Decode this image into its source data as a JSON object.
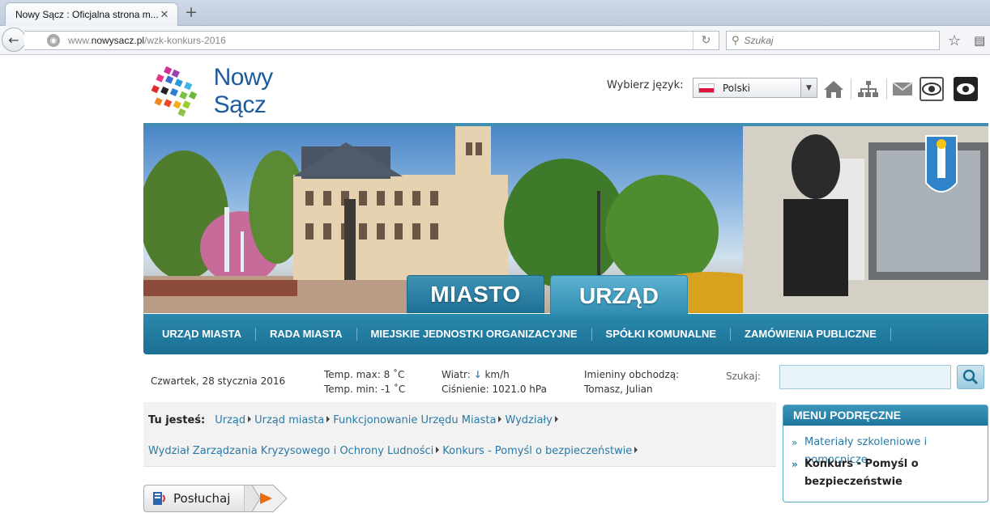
{
  "browser": {
    "tab_title": "Nowy Sącz : Oficjalna strona m...",
    "url_prefix": "www.",
    "url_domain": "nowysacz.pl",
    "url_path": "/wzk-konkurs-2016",
    "search_placeholder": "Szukaj"
  },
  "header": {
    "logo_text": "Nowy Sącz",
    "language_label": "Wybierz język:",
    "language_value": "Polski"
  },
  "banner": {
    "btn_miasto": "MIASTO",
    "btn_urzad": "URZĄD"
  },
  "nav": {
    "items": [
      "URZĄD MIASTA",
      "RADA MIASTA",
      "MIEJSKIE JEDNOSTKI ORGANIZACYJNE",
      "SPÓŁKI KOMUNALNE",
      "ZAMÓWIENIA PUBLICZNE"
    ]
  },
  "info": {
    "date": "Czwartek, 28 stycznia 2016",
    "temp_max": "Temp. max: 8 ˚C",
    "temp_min": "Temp. min: -1 ˚C",
    "wind_label": "Wiatr:",
    "wind_unit": "km/h",
    "pressure": "Ciśnienie: 1021.0 hPa",
    "nameday_label": "Imieniny obchodzą:",
    "nameday_names": "Tomasz, Julian",
    "search_label": "Szukaj:"
  },
  "breadcrumb": {
    "label": "Tu jesteś:",
    "items": [
      "Urząd",
      "Urząd miasta",
      "Funkcjonowanie Urzędu Miasta",
      "Wydziały",
      "Wydział Zarządzania Kryzysowego i Ochrony Ludności",
      "Konkurs - Pomyśl o bezpieczeństwie"
    ]
  },
  "listen": {
    "label": "Posłuchaj"
  },
  "menu": {
    "title": "MENU PODRĘCZNE",
    "items": [
      {
        "line1": "Materiały szkoleniowe i pomocnicze",
        "line2": ""
      },
      {
        "line1": "Konkurs - Pomyśl o",
        "line2": "bezpieczeństwie"
      }
    ]
  },
  "colors": {
    "accent": "#2a89ad",
    "link": "#2a7aa6",
    "logo_blue": "#1e5aa0"
  }
}
